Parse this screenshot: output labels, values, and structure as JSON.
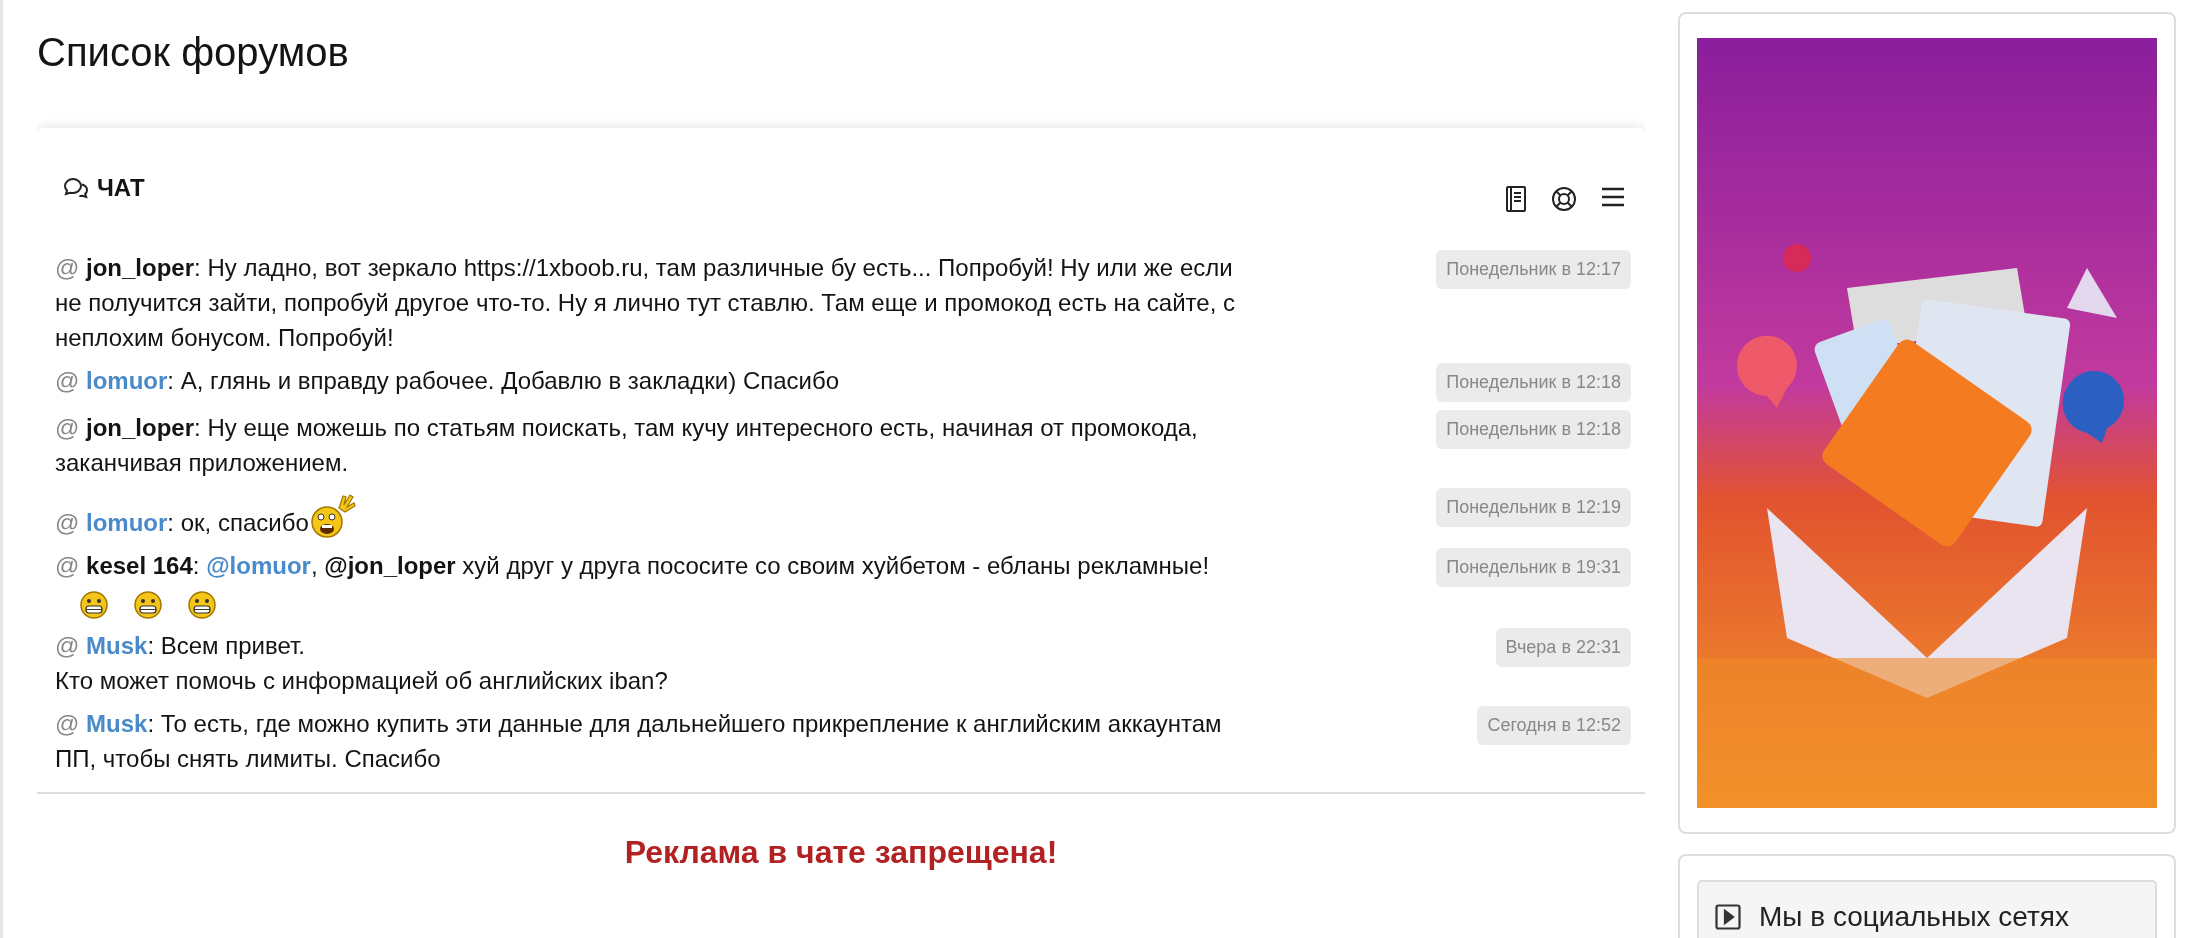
{
  "page_title": "Список форумов",
  "chat": {
    "title": "ЧАТ",
    "messages": [
      {
        "prefix": "@",
        "author": {
          "name": "jon_loper",
          "color": "#141414"
        },
        "segments": [
          {
            "kind": "text",
            "text": ": Ну ладно, вот зеркало https://1xboob.ru, там различные бу есть... Попробуй! Ну или же если не получится зайти, попробуй другое что-то. Ну я лично тут ставлю. Там еще и промокод есть на сайте, с неплохим бонусом. Попробуй!"
          }
        ],
        "time": "Понедельник в 12:17"
      },
      {
        "prefix": "@",
        "author": {
          "name": "lomuor",
          "color": "#4a8ac9"
        },
        "segments": [
          {
            "kind": "text",
            "text": ": А, глянь и вправду рабочее. Добавлю в закладки) Спасибо"
          }
        ],
        "time": "Понедельник в 12:18"
      },
      {
        "prefix": "@",
        "author": {
          "name": "jon_loper",
          "color": "#141414"
        },
        "segments": [
          {
            "kind": "text",
            "text": ": Ну еще можешь по статьям поискать, там кучу интересного есть, начиная от промокода, заканчивая приложением."
          }
        ],
        "time": "Понедельник в 12:18"
      },
      {
        "prefix": "@",
        "author": {
          "name": "lomuor",
          "color": "#4a8ac9"
        },
        "segments": [
          {
            "kind": "text",
            "text": ": ок, спасибо"
          },
          {
            "kind": "smiley-large"
          }
        ],
        "time": "Понедельник в 12:19"
      },
      {
        "prefix": "@",
        "author": {
          "name": "kesel 164",
          "color": "#141414"
        },
        "segments": [
          {
            "kind": "text",
            "text": ": "
          },
          {
            "kind": "mention",
            "text": "@lomuor",
            "color": "#4a8ac9"
          },
          {
            "kind": "text",
            "text": ", "
          },
          {
            "kind": "mention",
            "text": "@jon_loper",
            "color": "#141414"
          },
          {
            "kind": "text",
            "text": " хуй друг у друга пососите со своим хуйбетом - ебланы рекламные!"
          },
          {
            "kind": "smiley"
          },
          {
            "kind": "smiley"
          },
          {
            "kind": "smiley"
          }
        ],
        "time": "Понедельник в 19:31"
      },
      {
        "prefix": "@",
        "author": {
          "name": "Musk",
          "color": "#4a8ac9"
        },
        "segments": [
          {
            "kind": "text",
            "text": ": Всем привет.\nКто может помочь с информацией об английских iban?"
          }
        ],
        "time": "Вчера в 22:31"
      },
      {
        "prefix": "@",
        "author": {
          "name": "Musk",
          "color": "#4a8ac9"
        },
        "segments": [
          {
            "kind": "text",
            "text": ": То есть, где можно купить эти данные для дальнейшего прикрепление к английским аккаунтам ПП, чтобы снять лимиты. Спасибо"
          }
        ],
        "time": "Сегодня в 12:52"
      }
    ],
    "notice": "Реклама в чате запрещена!"
  },
  "sidebar": {
    "social": {
      "title": "Мы в социальных сетях"
    }
  }
}
